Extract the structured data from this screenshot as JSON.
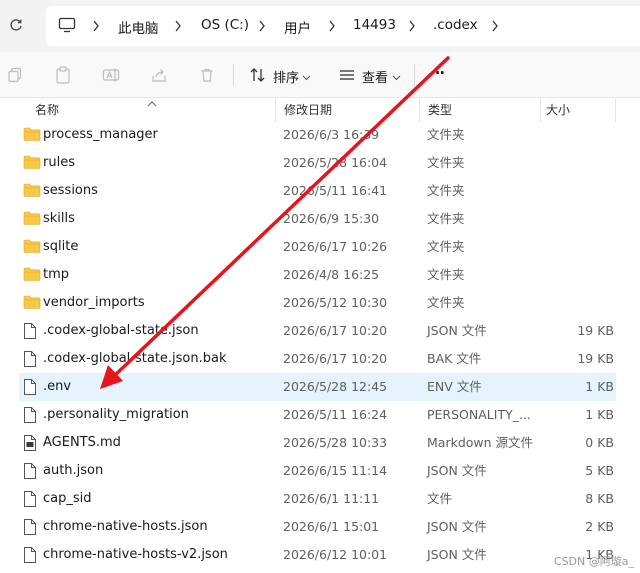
{
  "address": {
    "crumbs": [
      "此电脑",
      "OS (C:)",
      "用户",
      "14493",
      ".codex"
    ]
  },
  "toolbar": {
    "sort_label": "排序",
    "view_label": "查看",
    "more_label": "···"
  },
  "columns": {
    "name": "名称",
    "date": "修改日期",
    "type": "类型",
    "size": "大小"
  },
  "files": [
    {
      "name": "process_manager",
      "date": "2026/6/3 16:39",
      "type": "文件夹",
      "size": "",
      "kind": "folder"
    },
    {
      "name": "rules",
      "date": "2026/5/28 16:04",
      "type": "文件夹",
      "size": "",
      "kind": "folder"
    },
    {
      "name": "sessions",
      "date": "2026/5/11 16:41",
      "type": "文件夹",
      "size": "",
      "kind": "folder"
    },
    {
      "name": "skills",
      "date": "2026/6/9 15:30",
      "type": "文件夹",
      "size": "",
      "kind": "folder"
    },
    {
      "name": "sqlite",
      "date": "2026/6/17 10:26",
      "type": "文件夹",
      "size": "",
      "kind": "folder"
    },
    {
      "name": "tmp",
      "date": "2026/4/8 16:25",
      "type": "文件夹",
      "size": "",
      "kind": "folder"
    },
    {
      "name": "vendor_imports",
      "date": "2026/5/12 10:30",
      "type": "文件夹",
      "size": "",
      "kind": "folder"
    },
    {
      "name": ".codex-global-state.json",
      "date": "2026/6/17 10:20",
      "type": "JSON 文件",
      "size": "19 KB",
      "kind": "file"
    },
    {
      "name": ".codex-global-state.json.bak",
      "date": "2026/6/17 10:20",
      "type": "BAK 文件",
      "size": "19 KB",
      "kind": "file"
    },
    {
      "name": ".env",
      "date": "2026/5/28 12:45",
      "type": "ENV 文件",
      "size": "1 KB",
      "kind": "file",
      "selected": true
    },
    {
      "name": ".personality_migration",
      "date": "2026/5/11 16:24",
      "type": "PERSONALITY_...",
      "size": "1 KB",
      "kind": "file"
    },
    {
      "name": "AGENTS.md",
      "date": "2026/5/28 10:33",
      "type": "Markdown 源文件",
      "size": "0 KB",
      "kind": "md"
    },
    {
      "name": "auth.json",
      "date": "2026/6/15 11:14",
      "type": "JSON 文件",
      "size": "5 KB",
      "kind": "file"
    },
    {
      "name": "cap_sid",
      "date": "2026/6/1 11:11",
      "type": "文件",
      "size": "8 KB",
      "kind": "file"
    },
    {
      "name": "chrome-native-hosts.json",
      "date": "2026/6/1 15:01",
      "type": "JSON 文件",
      "size": "2 KB",
      "kind": "file"
    },
    {
      "name": "chrome-native-hosts-v2.json",
      "date": "2026/6/12 10:01",
      "type": "JSON 文件",
      "size": "1 KB",
      "kind": "file"
    }
  ],
  "watermark": "CSDN @阿璇a_",
  "colors": {
    "selected_row": "#e5f3ff",
    "folder": "#f8c846",
    "annotation_arrow": "#e8141c"
  }
}
